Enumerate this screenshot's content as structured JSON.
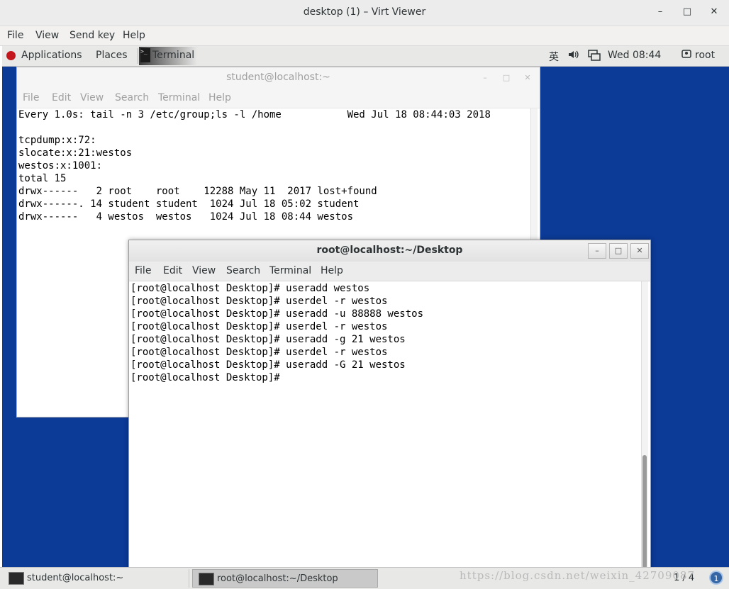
{
  "viewer": {
    "title": "desktop (1) – Virt Viewer",
    "controls": {
      "minimize": "–",
      "maximize": "□",
      "close": "✕"
    },
    "menu": [
      "File",
      "View",
      "Send key",
      "Help"
    ]
  },
  "topbar": {
    "applications": "Applications",
    "places": "Places",
    "terminal": "Terminal",
    "input_method": "英",
    "clock": "Wed 08:44",
    "user": "root",
    "icons": [
      "redhat-logo-icon",
      "terminal-icon",
      "volume-icon",
      "network-icon",
      "user-icon"
    ]
  },
  "window_back": {
    "title": "student@localhost:~",
    "menu": [
      "File",
      "Edit",
      "View",
      "Search",
      "Terminal",
      "Help"
    ],
    "controls": {
      "minimize": "–",
      "maximize": "□",
      "close": "✕"
    },
    "lines": [
      "Every 1.0s: tail -n 3 /etc/group;ls -l /home           Wed Jul 18 08:44:03 2018",
      "",
      "tcpdump:x:72:",
      "slocate:x:21:westos",
      "westos:x:1001:",
      "total 15",
      "drwx------   2 root    root    12288 May 11  2017 lost+found",
      "drwx------. 14 student student  1024 Jul 18 05:02 student",
      "drwx------   4 westos  westos   1024 Jul 18 08:44 westos"
    ]
  },
  "window_front": {
    "title": "root@localhost:~/Desktop",
    "menu": [
      "File",
      "Edit",
      "View",
      "Search",
      "Terminal",
      "Help"
    ],
    "controls": {
      "minimize": "–",
      "maximize": "□",
      "close": "✕"
    },
    "lines": [
      "[root@localhost Desktop]# useradd westos",
      "[root@localhost Desktop]# userdel -r westos",
      "[root@localhost Desktop]# useradd -u 88888 westos",
      "[root@localhost Desktop]# userdel -r westos",
      "[root@localhost Desktop]# useradd -g 21 westos",
      "[root@localhost Desktop]# userdel -r westos",
      "[root@localhost Desktop]# useradd -G 21 westos",
      "[root@localhost Desktop]# "
    ]
  },
  "taskbar": {
    "tasks": [
      "student@localhost:~",
      "root@localhost:~/Desktop"
    ],
    "workspace": "1 / 4",
    "workspace_badge": "1",
    "watermark": "https://blog.csdn.net/weixin_42709087"
  },
  "colors": {
    "desktop_bg": "#0b3a97",
    "accent": "#3465a4",
    "redhat": "#c4171d"
  }
}
